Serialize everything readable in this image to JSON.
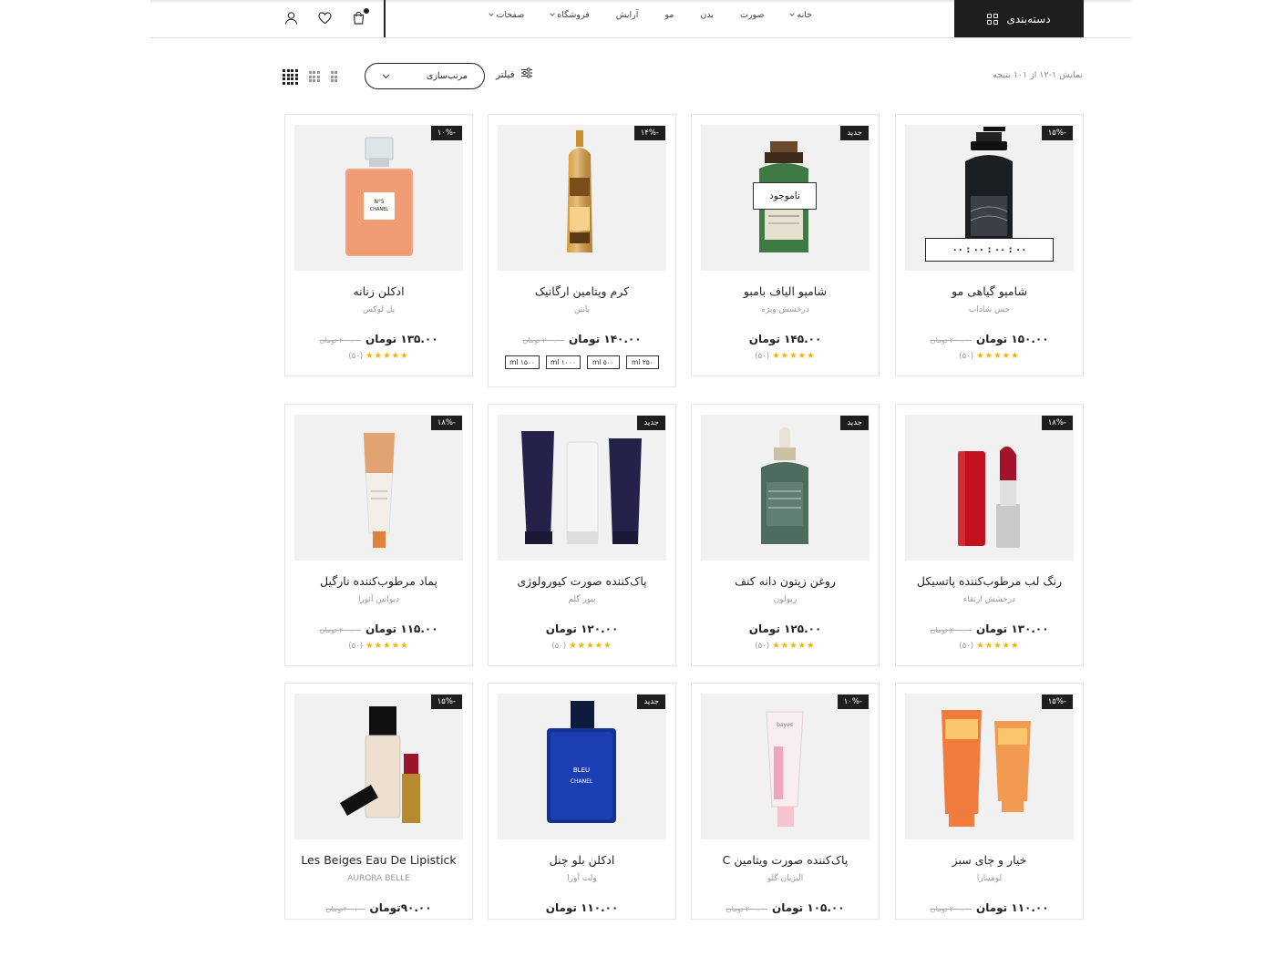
{
  "header": {
    "categories_label": "دسته‌بندی",
    "nav": [
      {
        "label": "خانه",
        "dropdown": true
      },
      {
        "label": "صورت",
        "dropdown": false
      },
      {
        "label": "بدن",
        "dropdown": false
      },
      {
        "label": "مو",
        "dropdown": false
      },
      {
        "label": "آرایش",
        "dropdown": false
      },
      {
        "label": "فروشگاه",
        "dropdown": true
      },
      {
        "label": "صفحات",
        "dropdown": true
      }
    ],
    "icons": [
      "user-icon",
      "heart-icon",
      "cart-icon"
    ]
  },
  "toolbar": {
    "result_text": "نمایش ۱-۱۲ از ۱۰۱ نتیجه",
    "filter_label": "فیلتر",
    "sort_label": "مرتب‌سازی"
  },
  "products": [
    {
      "title": "شامپو گیاهی مو",
      "brand": "حس شاداب",
      "price": "۱۵۰.۰۰ تومان",
      "old": "۲۰۰.۰۰ تومان",
      "badge": "-۱۵%",
      "rating": "(۵۰)",
      "timer": "۰۰ : ۰۰ : ۰۰ : ۰۰",
      "img": "pump"
    },
    {
      "title": "شامپو الیاف بامبو",
      "brand": "درخشش ویژه",
      "price": "۱۴۵.۰۰ تومان",
      "old": "",
      "badge": "جدید",
      "rating": "(۵۰)",
      "stock": "ناموجود",
      "img": "green"
    },
    {
      "title": "کرم ویتامین ارگانیک",
      "brand": "پانتن",
      "price": "۱۴۰.۰۰ تومان",
      "old": "۲۰۰.۰۰ تومان",
      "badge": "-۱۴%",
      "sizes": [
        "ml ۲۵۰",
        "ml ۵۰۰",
        "ml ۱۰۰۰",
        "ml ۱۵۰۰"
      ],
      "img": "gold"
    },
    {
      "title": "ادکلن زنانه",
      "brand": "پل لوکس",
      "price": "۱۳۵.۰۰ تومان",
      "old": "۲۰۰.۰۰ تومان",
      "badge": "-۱۰%",
      "rating": "(۵۰)",
      "img": "perfume"
    },
    {
      "title": "رنگ لب مرطوب‌کننده پاتسیکل",
      "brand": "درخشش ارتقاء",
      "price": "۱۳۰.۰۰ تومان",
      "old": "۲۰۰.۰۰ تومان",
      "badge": "-۱۸%",
      "rating": "(۵۰)",
      "img": "lipstick"
    },
    {
      "title": "روغن زیتون دانه کنف",
      "brand": "ریولون",
      "price": "۱۲۵.۰۰ تومان",
      "old": "",
      "badge": "جدید",
      "rating": "(۵۰)",
      "img": "dropper"
    },
    {
      "title": "پاک‌کننده صورت کیورولوژی",
      "brand": "پیور گلم",
      "price": "۱۲۰.۰۰ تومان",
      "old": "",
      "badge": "جدید",
      "rating": "(۵۰)",
      "img": "tubes"
    },
    {
      "title": "پماد مرطوب‌کننده نارگیل",
      "brand": "دیوانین آئورا",
      "price": "۱۱۵.۰۰ تومان",
      "old": "۲۰۰.۰۰ تومان",
      "badge": "-۱۸%",
      "rating": "(۵۰)",
      "img": "tube"
    },
    {
      "title": "خیار و چای سبز",
      "brand": "لومینارا",
      "price": "۱۱۰.۰۰ تومان",
      "old": "۲۰۰.۰۰ تومان",
      "badge": "-۱۵%",
      "img": "orange"
    },
    {
      "title": "پاک‌کننده صورت ویتامین C",
      "brand": "الیزیان گلو",
      "price": "۱۰۵.۰۰ تومان",
      "old": "۲۰۰.۰۰ تومان",
      "badge": "-۱۰%",
      "img": "pink"
    },
    {
      "title": "ادکلن بلو چنل",
      "brand": "ولت آورا",
      "price": "۱۱۰.۰۰ تومان",
      "old": "",
      "badge": "جدید",
      "img": "blue"
    },
    {
      "title": "Les Beiges Eau De Lipistick",
      "brand": "AURORA BELLE",
      "price": "۹۰.۰۰تومان",
      "old": "۲۰۰.۰۰تومان",
      "badge": "-۱۵%",
      "img": "beige"
    }
  ]
}
